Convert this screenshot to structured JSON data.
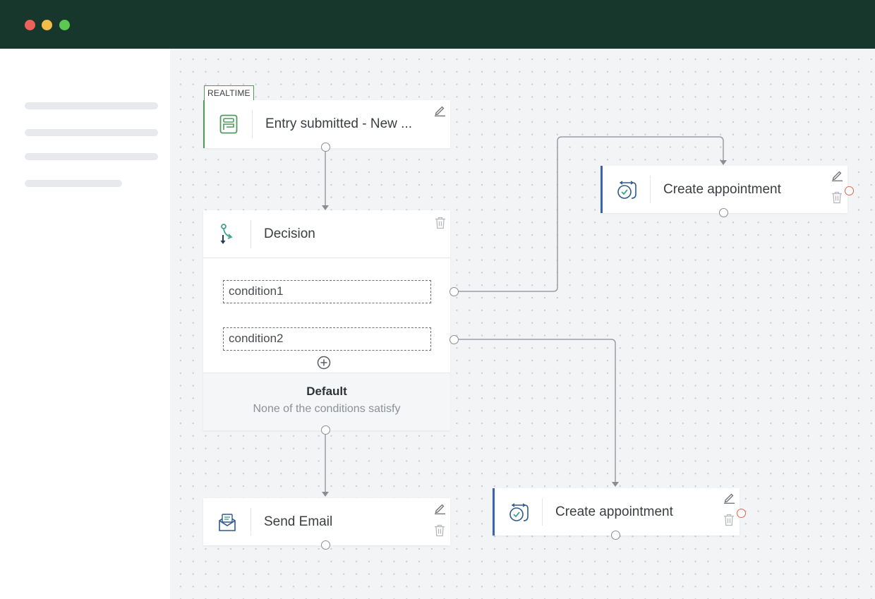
{
  "window": {
    "controls": [
      "close",
      "minimize",
      "maximize"
    ],
    "colors": {
      "titlebar": "#17372c",
      "close": "#ec6159",
      "minimize": "#f3bd4a",
      "maximize": "#5cc852"
    }
  },
  "sidebar": {
    "placeholder_items": 4
  },
  "canvas": {
    "trigger": {
      "badge": "REALTIME",
      "label": "Entry submitted - New ...",
      "icon": "form-icon",
      "accent": "#4f9a5d"
    },
    "decision": {
      "label": "Decision",
      "icon": "branch-icon",
      "conditions": [
        "condition1",
        "condition2"
      ],
      "default_title": "Default",
      "default_subtitle": "None of the conditions satisfy"
    },
    "send_email": {
      "label": "Send Email",
      "icon": "envelope-icon"
    },
    "appointment_top": {
      "label": "Create appointment",
      "icon": "calendar-check-icon",
      "accent": "#3a64b0"
    },
    "appointment_bottom": {
      "label": "Create appointment",
      "icon": "calendar-check-icon",
      "accent": "#3a64b0"
    }
  }
}
